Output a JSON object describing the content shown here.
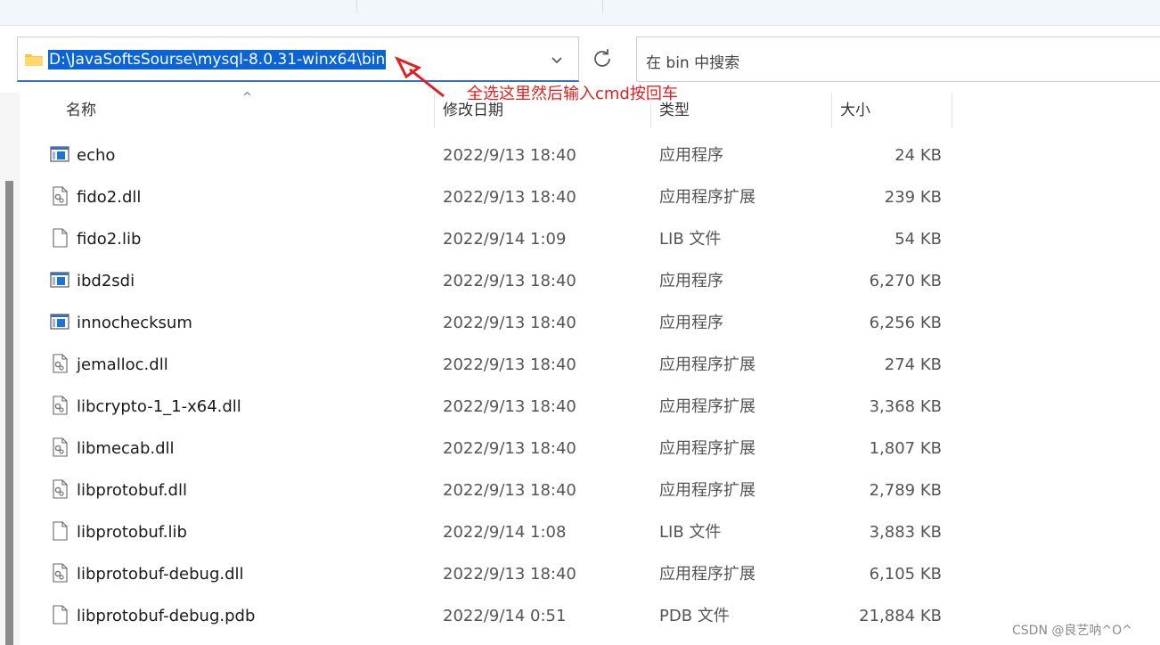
{
  "address": {
    "path": "D:\\JavaSoftsSourse\\mysql-8.0.31-winx64\\bin",
    "search_placeholder": "在 bin 中搜索"
  },
  "annotation": {
    "text": "全选这里然后输入cmd按回车",
    "color": "#e02020"
  },
  "columns": {
    "name": "名称",
    "date": "修改日期",
    "type": "类型",
    "size": "大小"
  },
  "files": [
    {
      "name": "echo",
      "date": "2022/9/13 18:40",
      "type": "应用程序",
      "size": "24 KB",
      "icon": "app-icon"
    },
    {
      "name": "fido2.dll",
      "date": "2022/9/13 18:40",
      "type": "应用程序扩展",
      "size": "239 KB",
      "icon": "dll-icon"
    },
    {
      "name": "fido2.lib",
      "date": "2022/9/14 1:09",
      "type": "LIB 文件",
      "size": "54 KB",
      "icon": "file-icon"
    },
    {
      "name": "ibd2sdi",
      "date": "2022/9/13 18:40",
      "type": "应用程序",
      "size": "6,270 KB",
      "icon": "app-icon"
    },
    {
      "name": "innochecksum",
      "date": "2022/9/13 18:40",
      "type": "应用程序",
      "size": "6,256 KB",
      "icon": "app-icon"
    },
    {
      "name": "jemalloc.dll",
      "date": "2022/9/13 18:40",
      "type": "应用程序扩展",
      "size": "274 KB",
      "icon": "dll-icon"
    },
    {
      "name": "libcrypto-1_1-x64.dll",
      "date": "2022/9/13 18:40",
      "type": "应用程序扩展",
      "size": "3,368 KB",
      "icon": "dll-icon"
    },
    {
      "name": "libmecab.dll",
      "date": "2022/9/13 18:40",
      "type": "应用程序扩展",
      "size": "1,807 KB",
      "icon": "dll-icon"
    },
    {
      "name": "libprotobuf.dll",
      "date": "2022/9/13 18:40",
      "type": "应用程序扩展",
      "size": "2,789 KB",
      "icon": "dll-icon"
    },
    {
      "name": "libprotobuf.lib",
      "date": "2022/9/14 1:08",
      "type": "LIB 文件",
      "size": "3,883 KB",
      "icon": "file-icon"
    },
    {
      "name": "libprotobuf-debug.dll",
      "date": "2022/9/13 18:40",
      "type": "应用程序扩展",
      "size": "6,105 KB",
      "icon": "dll-icon"
    },
    {
      "name": "libprotobuf-debug.pdb",
      "date": "2022/9/14 0:51",
      "type": "PDB 文件",
      "size": "21,884 KB",
      "icon": "file-icon"
    }
  ],
  "watermark": "CSDN @良艺呐^O^"
}
